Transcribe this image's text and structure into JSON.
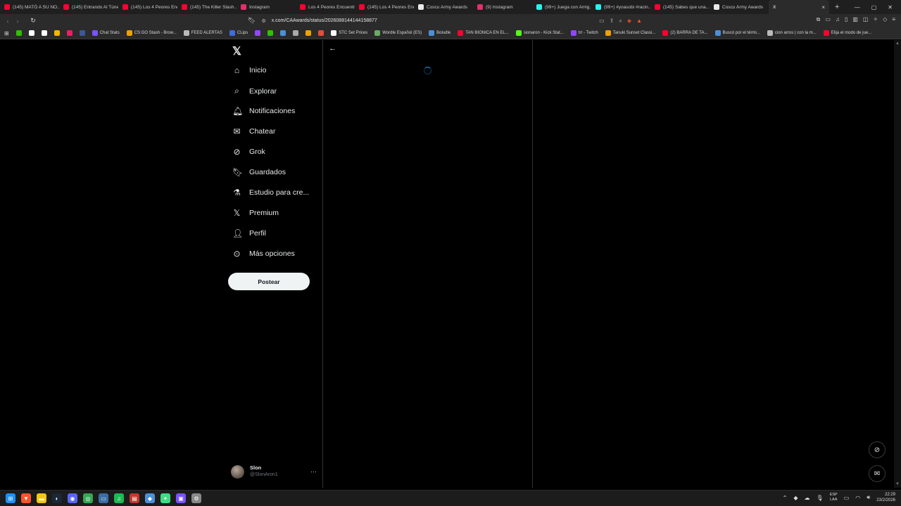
{
  "browser": {
    "tabs": [
      {
        "title": "(145) MATÓ A SU NO...",
        "favicon_color": "#ff0033"
      },
      {
        "title": "(145) Entrando Al Túne...",
        "favicon_color": "#ff0033"
      },
      {
        "title": "(145) Los 4 Peores Enc...",
        "favicon_color": "#ff0033"
      },
      {
        "title": "(145) The Killer Slash...",
        "favicon_color": "#ff0033"
      },
      {
        "title": "Instagram",
        "favicon_color": "#e1306c"
      },
      {
        "title": "Los 4 Peores Encuentr...",
        "favicon_color": "#ff0033"
      },
      {
        "title": "(145) Los 4 Peores Enc...",
        "favicon_color": "#ff0033"
      },
      {
        "title": "Coscu Army Awards",
        "favicon_color": "#e7e9ea"
      },
      {
        "title": "(9) Instagram",
        "favicon_color": "#e1306c"
      },
      {
        "title": "(99+) Juega con Amig...",
        "favicon_color": "#25f4ee"
      },
      {
        "title": "(99+) #yoasobi #racin...",
        "favicon_color": "#25f4ee"
      },
      {
        "title": "(145) Sabes que una...",
        "favicon_color": "#ff0033"
      },
      {
        "title": "Coscu Army Awards",
        "favicon_color": "#e7e9ea"
      }
    ],
    "active_tab": {
      "title": "X",
      "close": "×"
    },
    "new_tab": "+",
    "window_controls": [
      "—",
      "▢",
      "✕"
    ],
    "url": "x.com/CAAwards/status/2026088144144158877",
    "bookmarks": [
      {
        "label": "",
        "color": "#2dc100"
      },
      {
        "label": "",
        "color": "#ffffff"
      },
      {
        "label": "",
        "color": "#ffffff"
      },
      {
        "label": "",
        "color": "#f7b500"
      },
      {
        "label": "",
        "color": "#e91e63"
      },
      {
        "label": "",
        "color": "#3b5998"
      },
      {
        "label": "Chat Stats",
        "color": "#7b52ff"
      },
      {
        "label": "CS:GO Stash - Brow...",
        "color": "#f0a000"
      },
      {
        "label": "FEED ALERTAS",
        "color": "#bbbbbb"
      },
      {
        "label": "CLips",
        "color": "#3d6be0"
      },
      {
        "label": "",
        "color": "#9146ff"
      },
      {
        "label": "",
        "color": "#2dc100"
      },
      {
        "label": "",
        "color": "#4a90d9"
      },
      {
        "label": "",
        "color": "#aaaaaa"
      },
      {
        "label": "",
        "color": "#f0a000"
      },
      {
        "label": "",
        "color": "#e74c3c"
      },
      {
        "label": "STC Set Prices",
        "color": "#ffffff"
      },
      {
        "label": "Wordle Español (ES)",
        "color": "#6aaa64"
      },
      {
        "label": "Boludle",
        "color": "#4a90d9"
      },
      {
        "label": "TAN BIONICA EN EL...",
        "color": "#ff0033"
      },
      {
        "label": "sionaron - Kick Stat...",
        "color": "#53fc18"
      },
      {
        "label": "trr - Twitch",
        "color": "#9146ff"
      },
      {
        "label": "Tanuki Sunset Classi...",
        "color": "#f0a000"
      },
      {
        "label": "(2) BARRA DE TA...",
        "color": "#ff0033"
      },
      {
        "label": "Buscó por el térmi...",
        "color": "#4a90d9"
      },
      {
        "label": "cion arros | con la m...",
        "color": "#bbbbbb"
      },
      {
        "label": "Elija el modo de jue...",
        "color": "#ff0033"
      }
    ]
  },
  "sidebar": {
    "logo": "𝕏",
    "items": [
      {
        "label": "Inicio",
        "icon": "home-icon",
        "glyph": "⌂"
      },
      {
        "label": "Explorar",
        "icon": "search-icon",
        "glyph": "⌕"
      },
      {
        "label": "Notificaciones",
        "icon": "bell-icon",
        "glyph": "🔔︎"
      },
      {
        "label": "Chatear",
        "icon": "mail-icon",
        "glyph": "✉"
      },
      {
        "label": "Grok",
        "icon": "grok-icon",
        "glyph": "⊘"
      },
      {
        "label": "Guardados",
        "icon": "bookmark-icon",
        "glyph": "🔖︎"
      },
      {
        "label": "Estudio para cre...",
        "icon": "flask-icon",
        "glyph": "⚗"
      },
      {
        "label": "Premium",
        "icon": "x-logo-icon",
        "glyph": "𝕏"
      },
      {
        "label": "Perfil",
        "icon": "person-icon",
        "glyph": "👤︎"
      },
      {
        "label": "Más opciones",
        "icon": "more-circle-icon",
        "glyph": "⊙"
      }
    ],
    "post_button": "Postear",
    "account": {
      "name": "Slon",
      "handle": "@SlonAron1",
      "more": "···"
    }
  },
  "main": {
    "back": "←"
  },
  "fabs": {
    "grok": "⊘",
    "messages": "✉"
  },
  "taskbar": {
    "apps": [
      {
        "name": "windows-start",
        "glyph": "⊞",
        "color": "#1e90ff"
      },
      {
        "name": "brave",
        "glyph": "▼",
        "color": "#fb542b"
      },
      {
        "name": "file-explorer",
        "glyph": "▬",
        "color": "#f5c518"
      },
      {
        "name": "steam",
        "glyph": "◐",
        "color": "#1b2838"
      },
      {
        "name": "discord",
        "glyph": "◉",
        "color": "#5865f2"
      },
      {
        "name": "chrome",
        "glyph": "◎",
        "color": "#34a853"
      },
      {
        "name": "monitor",
        "glyph": "▭",
        "color": "#3a6ea5"
      },
      {
        "name": "spotify",
        "glyph": "♫",
        "color": "#1db954"
      },
      {
        "name": "recorder",
        "glyph": "▤",
        "color": "#c0392b"
      },
      {
        "name": "app",
        "glyph": "◆",
        "color": "#4a90d9"
      },
      {
        "name": "app2",
        "glyph": "✦",
        "color": "#3ddc84"
      },
      {
        "name": "app3",
        "glyph": "▣",
        "color": "#7b52ff"
      },
      {
        "name": "settings",
        "glyph": "⚙",
        "color": "#888888"
      }
    ],
    "lang_top": "ESP",
    "lang_bottom": "LAA",
    "time": "22:29",
    "date": "23/2/2026"
  }
}
